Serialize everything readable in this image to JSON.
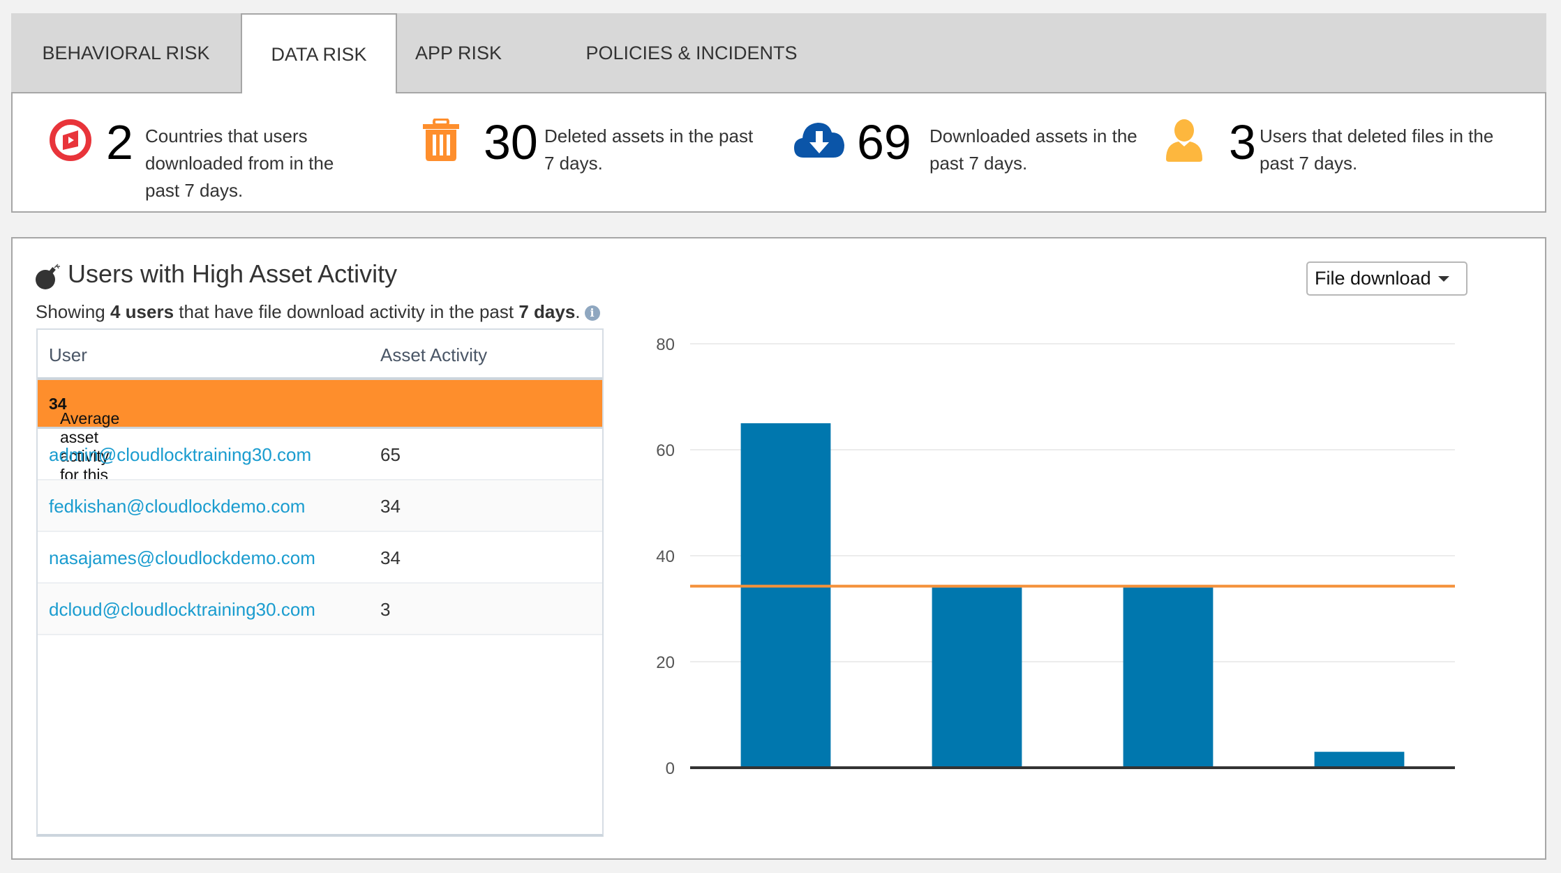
{
  "tabs": [
    {
      "label": "BEHAVIORAL RISK",
      "active": false
    },
    {
      "label": "DATA RISK",
      "active": true
    },
    {
      "label": "APP RISK",
      "active": false
    },
    {
      "label": "POLICIES & INCIDENTS",
      "active": false
    }
  ],
  "stats": [
    {
      "icon": "location-arrow-icon",
      "value": "2",
      "description": "Countries that users downloaded from in the past 7 days.",
      "color": "#e8343a"
    },
    {
      "icon": "trash-icon",
      "value": "30",
      "description": "Deleted assets in the past 7 days.",
      "color": "#fe8e2c"
    },
    {
      "icon": "cloud-download-icon",
      "value": "69",
      "description": "Downloaded assets in the past 7 days.",
      "color": "#0b55a8"
    },
    {
      "icon": "user-icon",
      "value": "3",
      "description": "Users that deleted files in the past 7 days.",
      "color": "#fdb73e"
    }
  ],
  "panel": {
    "title": "Users with High Asset Activity",
    "subtitle": {
      "prefix": "Showing ",
      "count": "4 users",
      "middle": " that have file download activity in the past ",
      "period": "7 days",
      "suffix": "."
    },
    "dropdown": {
      "selected": "File download"
    },
    "table": {
      "columns": [
        "User",
        "Asset Activity"
      ],
      "average_label": "Average asset activity for this time period:",
      "average_value": "34",
      "rows": [
        {
          "user": "admin@cloudlocktraining30.com",
          "activity": "65"
        },
        {
          "user": "fedkishan@cloudlockdemo.com",
          "activity": "34"
        },
        {
          "user": "nasajames@cloudlockdemo.com",
          "activity": "34"
        },
        {
          "user": "dcloud@cloudlocktraining30.com",
          "activity": "3"
        }
      ]
    }
  },
  "colors": {
    "bar": "#0077ae",
    "average_line": "#f4913a",
    "accent_orange": "#fe8e2c",
    "link": "#1a9ccf"
  },
  "chart_data": {
    "type": "bar",
    "title": "",
    "xlabel": "",
    "ylabel": "",
    "categories": [
      "admin@cloudlocktraining30.com",
      "fedkishan@cloudlockdemo.com",
      "nasajames@cloudlockdemo.com",
      "dcloud@cloudlocktraining30.com"
    ],
    "values": [
      65,
      34,
      34,
      3
    ],
    "average": 34,
    "ylim": [
      0,
      80
    ],
    "yticks": [
      0,
      20,
      40,
      60,
      80
    ],
    "grid": true,
    "legend": "none"
  }
}
